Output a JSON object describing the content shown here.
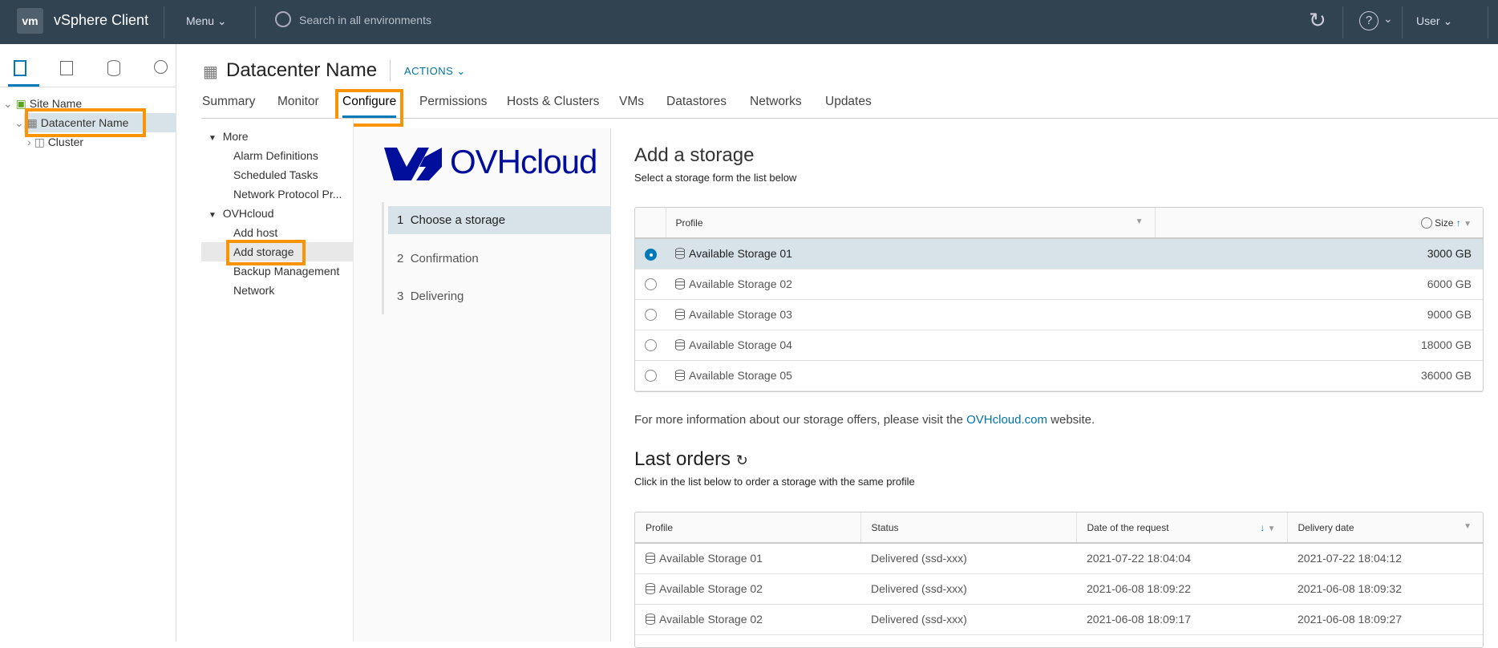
{
  "header": {
    "logo": "vm",
    "app_title": "vSphere Client",
    "menu": "Menu",
    "search_placeholder": "Search in all environments",
    "user": "User"
  },
  "sidebar": {
    "tree": [
      {
        "label": "Site Name"
      },
      {
        "label": "Datacenter Name"
      },
      {
        "label": "Cluster"
      }
    ]
  },
  "object": {
    "title": "Datacenter Name",
    "actions": "ACTIONS"
  },
  "tabs": [
    "Summary",
    "Monitor",
    "Configure",
    "Permissions",
    "Hosts & Clusters",
    "VMs",
    "Datastores",
    "Networks",
    "Updates"
  ],
  "config_nav": {
    "groups": [
      {
        "label": "More",
        "items": [
          "Alarm Definitions",
          "Scheduled Tasks",
          "Network Protocol Pr..."
        ]
      },
      {
        "label": "OVHcloud",
        "items": [
          "Add host",
          "Add storage",
          "Backup Management",
          "Network"
        ]
      }
    ]
  },
  "wizard": {
    "brand": "OVHcloud",
    "steps": [
      {
        "num": "1",
        "label": "Choose a storage"
      },
      {
        "num": "2",
        "label": "Confirmation"
      },
      {
        "num": "3",
        "label": "Delivering"
      }
    ]
  },
  "add_storage": {
    "title": "Add a storage",
    "subtitle": "Select a storage form the list below",
    "columns": [
      "Profile",
      "Size"
    ],
    "rows": [
      {
        "profile": "Available Storage 01",
        "size": "3000 GB",
        "selected": true
      },
      {
        "profile": "Available Storage 02",
        "size": "6000 GB"
      },
      {
        "profile": "Available Storage 03",
        "size": "9000 GB"
      },
      {
        "profile": "Available Storage 04",
        "size": "18000 GB"
      },
      {
        "profile": "Available Storage 05",
        "size": "36000 GB"
      }
    ],
    "info_prefix": "For more information about our storage offers, please visit the ",
    "info_link": "OVHcloud.com",
    "info_suffix": " website."
  },
  "last_orders": {
    "title": "Last orders",
    "subtitle": "Click in the list below to order a storage with the same profile",
    "columns": [
      "Profile",
      "Status",
      "Date of the request",
      "Delivery date"
    ],
    "rows": [
      {
        "profile": "Available Storage 01",
        "status": "Delivered (ssd-xxx)",
        "requested": "2021-07-22 18:04:04",
        "delivered": "2021-07-22 18:04:12"
      },
      {
        "profile": "Available Storage 02",
        "status": "Delivered (ssd-xxx)",
        "requested": "2021-06-08 18:09:22",
        "delivered": "2021-06-08 18:09:32"
      },
      {
        "profile": "Available Storage 02",
        "status": "Delivered (ssd-xxx)",
        "requested": "2021-06-08 18:09:17",
        "delivered": "2021-06-08 18:09:27"
      }
    ]
  },
  "colors": {
    "header_bg": "#314351",
    "accent": "#0079b8",
    "highlight": "#f89406",
    "brand": "#000e9c"
  }
}
